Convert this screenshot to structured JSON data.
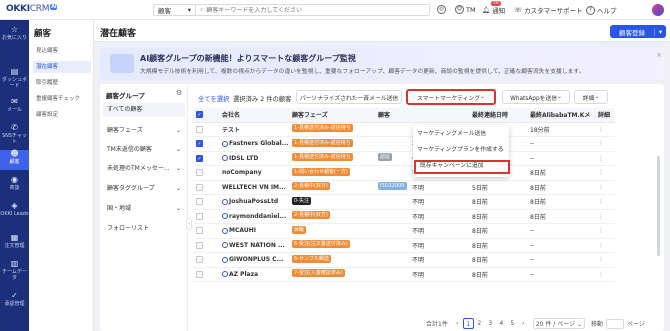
{
  "app": {
    "logo": "OKKI",
    "logo_crm": "CRM",
    "logo_badge": "AI"
  },
  "topbar": {
    "search_scope": "顧客",
    "search_placeholder": "顧客キーワードを入力してください",
    "tm_label": "TM",
    "notify_label": "通知",
    "notify_count": "48",
    "support_label": "カスタマーサポート",
    "help_label": "ヘルプ"
  },
  "leftnav": [
    {
      "label": "お気に入り",
      "icon": "star-icon"
    },
    {
      "label": "ダッシュボード",
      "icon": "dashboard-icon"
    },
    {
      "label": "メール",
      "icon": "mail-icon"
    },
    {
      "label": "SNSチャット",
      "icon": "chat-icon"
    },
    {
      "label": "顧客",
      "icon": "customer-icon"
    },
    {
      "label": "商談",
      "icon": "deal-icon"
    },
    {
      "label": "OKKI Leads",
      "icon": "leads-icon"
    },
    {
      "label": "注文管理",
      "icon": "order-icon"
    },
    {
      "label": "チームデータ",
      "icon": "team-data-icon"
    },
    {
      "label": "承認管理",
      "icon": "approval-icon"
    }
  ],
  "sidebar": {
    "title": "顧客",
    "items": [
      "見込顧客",
      "潜在顧客",
      "取引履歴",
      "重複顧客チェック",
      "顧客設定"
    ]
  },
  "header": {
    "title": "潜在顧客",
    "register": "顧客登録"
  },
  "banner": {
    "title": "AI顧客グループの新機能！よりスマートな顧客グループ監視",
    "desc": "大規模モデル技術を利用して、複数の視点からデータの違いを監視し、重要なフォローアップ、顧客データの更新、商談の監視を提供して、正確な顧客流失を支援します。"
  },
  "groups": {
    "title": "顧客グループ",
    "items": [
      "すべての顧客",
      "顧客フェーズ",
      "TM未返信の顧客",
      "未処理のTMメッセー...",
      "顧客タググループ",
      "国・地域",
      "フォローリスト"
    ]
  },
  "toolbar": {
    "select_all": "全てを選択",
    "selected": "選択済み 2 件の顧客",
    "personalized": "パーソナライズされた一斉メール送信",
    "smart": "スマートマーケティング",
    "whatsapp": "WhatsAppを送信",
    "detail": "詳細"
  },
  "menu": [
    "マーケティングメール送信",
    "マーケティングプランを作成する",
    "既存キャンペーンに追加"
  ],
  "table": {
    "headers": [
      "会社名",
      "顧客フェーズ",
      "顧客",
      "",
      "最終連絡日時",
      "最終AlibabaTM.Kメ",
      "詳細"
    ],
    "rows": [
      {
        "name": "テスト",
        "icon": false,
        "checked": false,
        "phase": "1-見積送付済み-返信待ち",
        "phase_color": "#f08c36",
        "tag": "",
        "tag_color": "",
        "level": "",
        "last": "18分前",
        "ali": "18分前"
      },
      {
        "name": "Fastners Global...",
        "icon": true,
        "checked": true,
        "phase": "1-見積送付済み-返信待ち",
        "phase_color": "#f08c36",
        "tag": "",
        "tag_color": "",
        "level": "不明",
        "last": "1日前",
        "ali": "--"
      },
      {
        "name": "IDSL LTD",
        "icon": true,
        "checked": true,
        "phase": "1-見積送付済み-返信待ち",
        "phase_color": "#f08c36",
        "tag": "認証",
        "tag_color": "#9aa0a8",
        "level": "低",
        "last": "1日前",
        "ali": "--"
      },
      {
        "name": "noCompany",
        "icon": false,
        "checked": false,
        "phase": "1-問い合わせ顧客(一方)",
        "phase_color": "#f08c36",
        "tag": "",
        "tag_color": "",
        "level": "不明",
        "last": "3日前",
        "ali": "8日前"
      },
      {
        "name": "WELLTECH VN IM...",
        "icon": false,
        "checked": false,
        "phase": "2-見積中(双方)",
        "phase_color": "#f08c36",
        "tag": "ISO22000",
        "tag_color": "#7fb0e8",
        "level": "不明",
        "last": "5日前",
        "ali": "8日前"
      },
      {
        "name": "JoshuaPossLtd",
        "icon": true,
        "checked": false,
        "phase": "0-失注",
        "phase_color": "#222222",
        "tag": "",
        "tag_color": "",
        "level": "不明",
        "last": "8日前",
        "ali": "8日前"
      },
      {
        "name": "raymonddaniel...",
        "icon": true,
        "checked": false,
        "phase": "2-見積中(双方)",
        "phase_color": "#f08c36",
        "tag": "",
        "tag_color": "",
        "level": "不明",
        "last": "8日前",
        "ali": "8日前"
      },
      {
        "name": "MCAUHI",
        "icon": true,
        "checked": false,
        "phase": "休眠",
        "phase_color": "#f08c36",
        "tag": "",
        "tag_color": "",
        "level": "不明",
        "last": "8日前",
        "ali": "--"
      },
      {
        "name": "WEST NATION ...",
        "icon": true,
        "checked": false,
        "phase": "6-受注(注文書送付済み)",
        "phase_color": "#f08c36",
        "tag": "",
        "tag_color": "",
        "level": "不明",
        "last": "8日前",
        "ali": "--"
      },
      {
        "name": "GIWONPLUS C...",
        "icon": true,
        "checked": false,
        "phase": "5-サンプル郵送",
        "phase_color": "#f08c36",
        "tag": "",
        "tag_color": "",
        "level": "不明",
        "last": "8日前",
        "ali": "--"
      },
      {
        "name": "AZ Plaza",
        "icon": true,
        "checked": false,
        "phase": "7-受注(入金確認済み)",
        "phase_color": "#f08c36",
        "tag": "",
        "tag_color": "",
        "level": "不明",
        "last": "8日前",
        "ali": "--"
      }
    ]
  },
  "pager": {
    "total": "合計1件",
    "pages": [
      "1",
      "2",
      "3",
      "4",
      "5"
    ],
    "per_page": "20 件 / ページ",
    "goto": "移動",
    "page_suffix": "ページ"
  }
}
